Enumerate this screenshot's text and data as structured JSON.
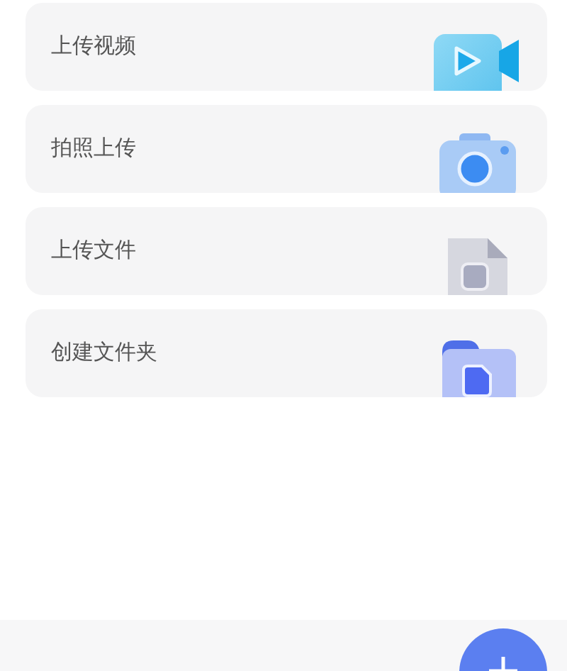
{
  "actions": [
    {
      "label": "上传视频",
      "kind": "video"
    },
    {
      "label": "拍照上传",
      "kind": "camera"
    },
    {
      "label": "上传文件",
      "kind": "file"
    },
    {
      "label": "创建文件夹",
      "kind": "folder"
    }
  ]
}
